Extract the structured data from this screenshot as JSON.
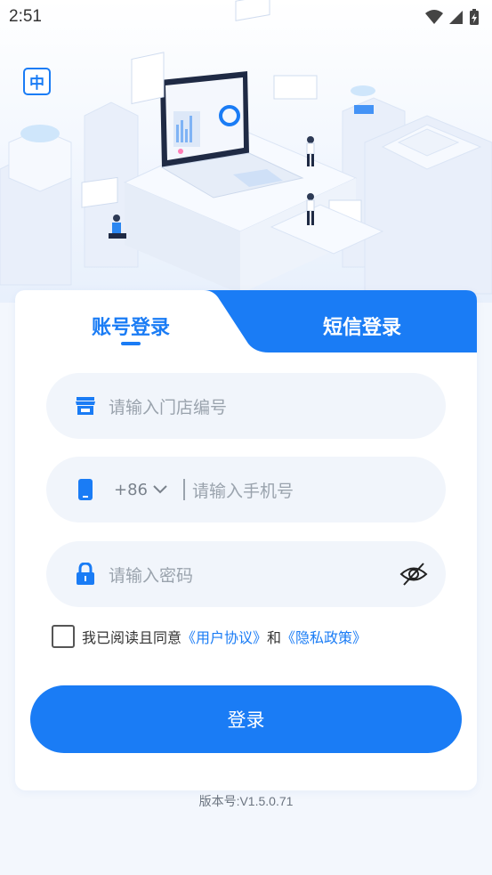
{
  "status_bar": {
    "time": "2:51"
  },
  "header": {
    "language_button": "中"
  },
  "tabs": [
    {
      "label": "账号登录",
      "active": true
    },
    {
      "label": "短信登录",
      "active": false
    }
  ],
  "form": {
    "store_placeholder": "请输入门店编号",
    "country_code": "+86",
    "phone_placeholder": "请输入手机号",
    "password_placeholder": "请输入密码"
  },
  "agreement": {
    "prefix": "我已阅读且同意",
    "user_agreement": "《用户协议》",
    "and": "和",
    "privacy_policy": "《隐私政策》",
    "checked": false
  },
  "login_button": "登录",
  "version": "版本号:V1.5.0.71",
  "colors": {
    "primary": "#1a7cf5",
    "field_bg": "#f1f5fb",
    "placeholder": "#9aa3ad"
  }
}
